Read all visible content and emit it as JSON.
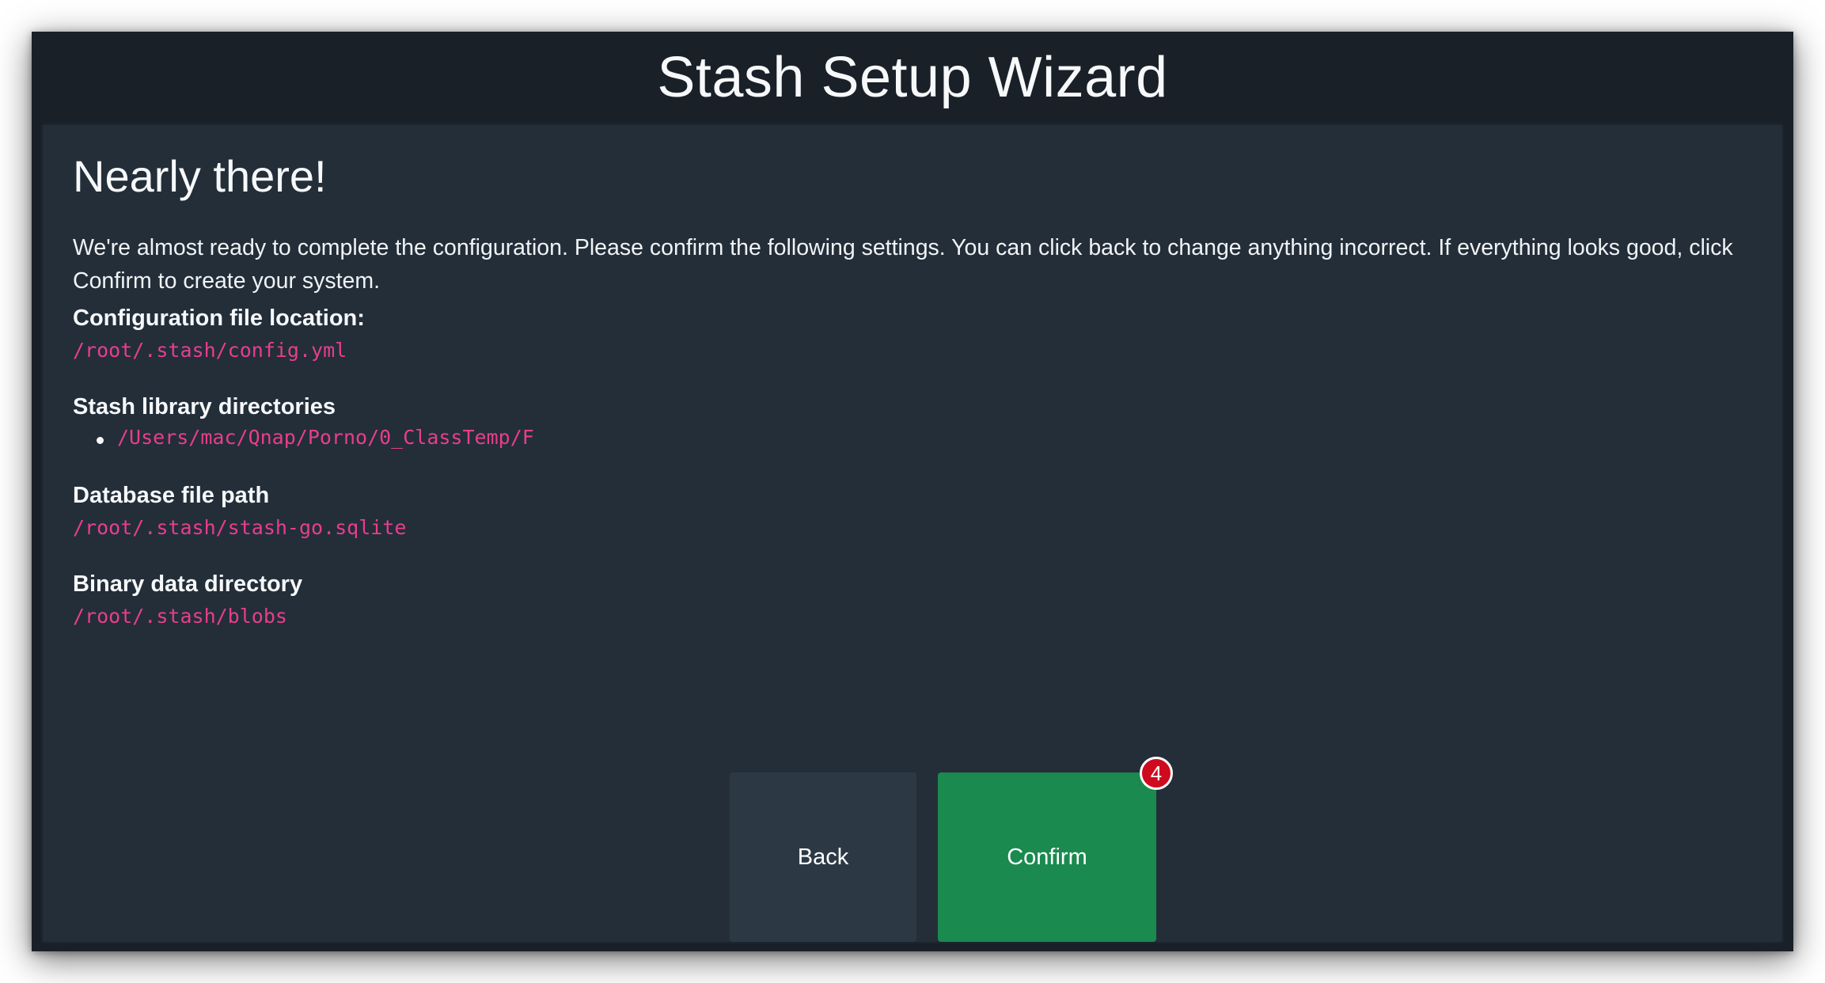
{
  "wizard": {
    "title": "Stash Setup Wizard"
  },
  "step": {
    "heading": "Nearly there!",
    "intro": "We're almost ready to complete the configuration. Please confirm the following settings. You can click back to change anything incorrect. If everything looks good, click Confirm to create your system."
  },
  "settings": {
    "config_label": "Configuration file location:",
    "config_value": "/root/.stash/config.yml",
    "library_label": "Stash library directories",
    "library_dirs": [
      "/Users/mac/Qnap/Porno/0_ClassTemp/F"
    ],
    "database_label": "Database file path",
    "database_value": "/root/.stash/stash-go.sqlite",
    "blobs_label": "Binary data directory",
    "blobs_value": "/root/.stash/blobs"
  },
  "actions": {
    "back_label": "Back",
    "confirm_label": "Confirm",
    "confirm_badge": "4"
  },
  "colors": {
    "background": "#1a2027",
    "card": "#232e39",
    "code_text": "#e83e8c",
    "back_button": "#2c3945",
    "confirm_button": "#1a8a4e",
    "badge": "#cf0a1f"
  }
}
